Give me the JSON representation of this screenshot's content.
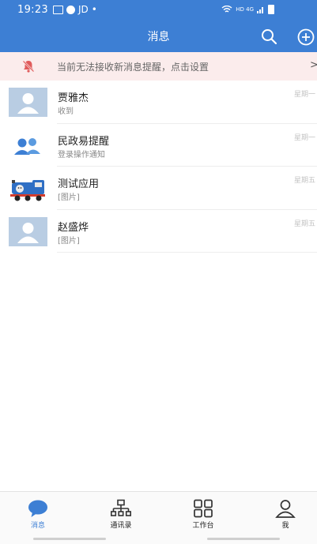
{
  "status_bar": {
    "time": "19:23",
    "carrier": "JD",
    "dot": "•",
    "network": "HD 4G"
  },
  "header": {
    "title": "消息"
  },
  "notice": {
    "text": "当前无法接收新消息提醒，点击设置",
    "arrow": ">"
  },
  "messages": [
    {
      "name": "贾雅杰",
      "preview": "收到",
      "time": "星期一",
      "avatar": "default-person"
    },
    {
      "name": "民政易提醒",
      "preview": "登录操作通知",
      "time": "星期一",
      "avatar": "group"
    },
    {
      "name": "测试应用",
      "preview": "[图片]",
      "time": "星期五",
      "avatar": "train"
    },
    {
      "name": "赵盛烨",
      "preview": "[图片]",
      "time": "星期五",
      "avatar": "default-person"
    }
  ],
  "nav": [
    {
      "label": "消息",
      "icon": "chat-bubble-icon",
      "active": true
    },
    {
      "label": "通讯录",
      "icon": "org-chart-icon",
      "active": false
    },
    {
      "label": "工作台",
      "icon": "grid-icon",
      "active": false
    },
    {
      "label": "我",
      "icon": "person-icon",
      "active": false
    }
  ],
  "colors": {
    "header": "#3d7fd4",
    "notice_bg": "#fbecec",
    "notice_icon": "#e05b5b",
    "avatar_bg": "#b9cde3"
  }
}
